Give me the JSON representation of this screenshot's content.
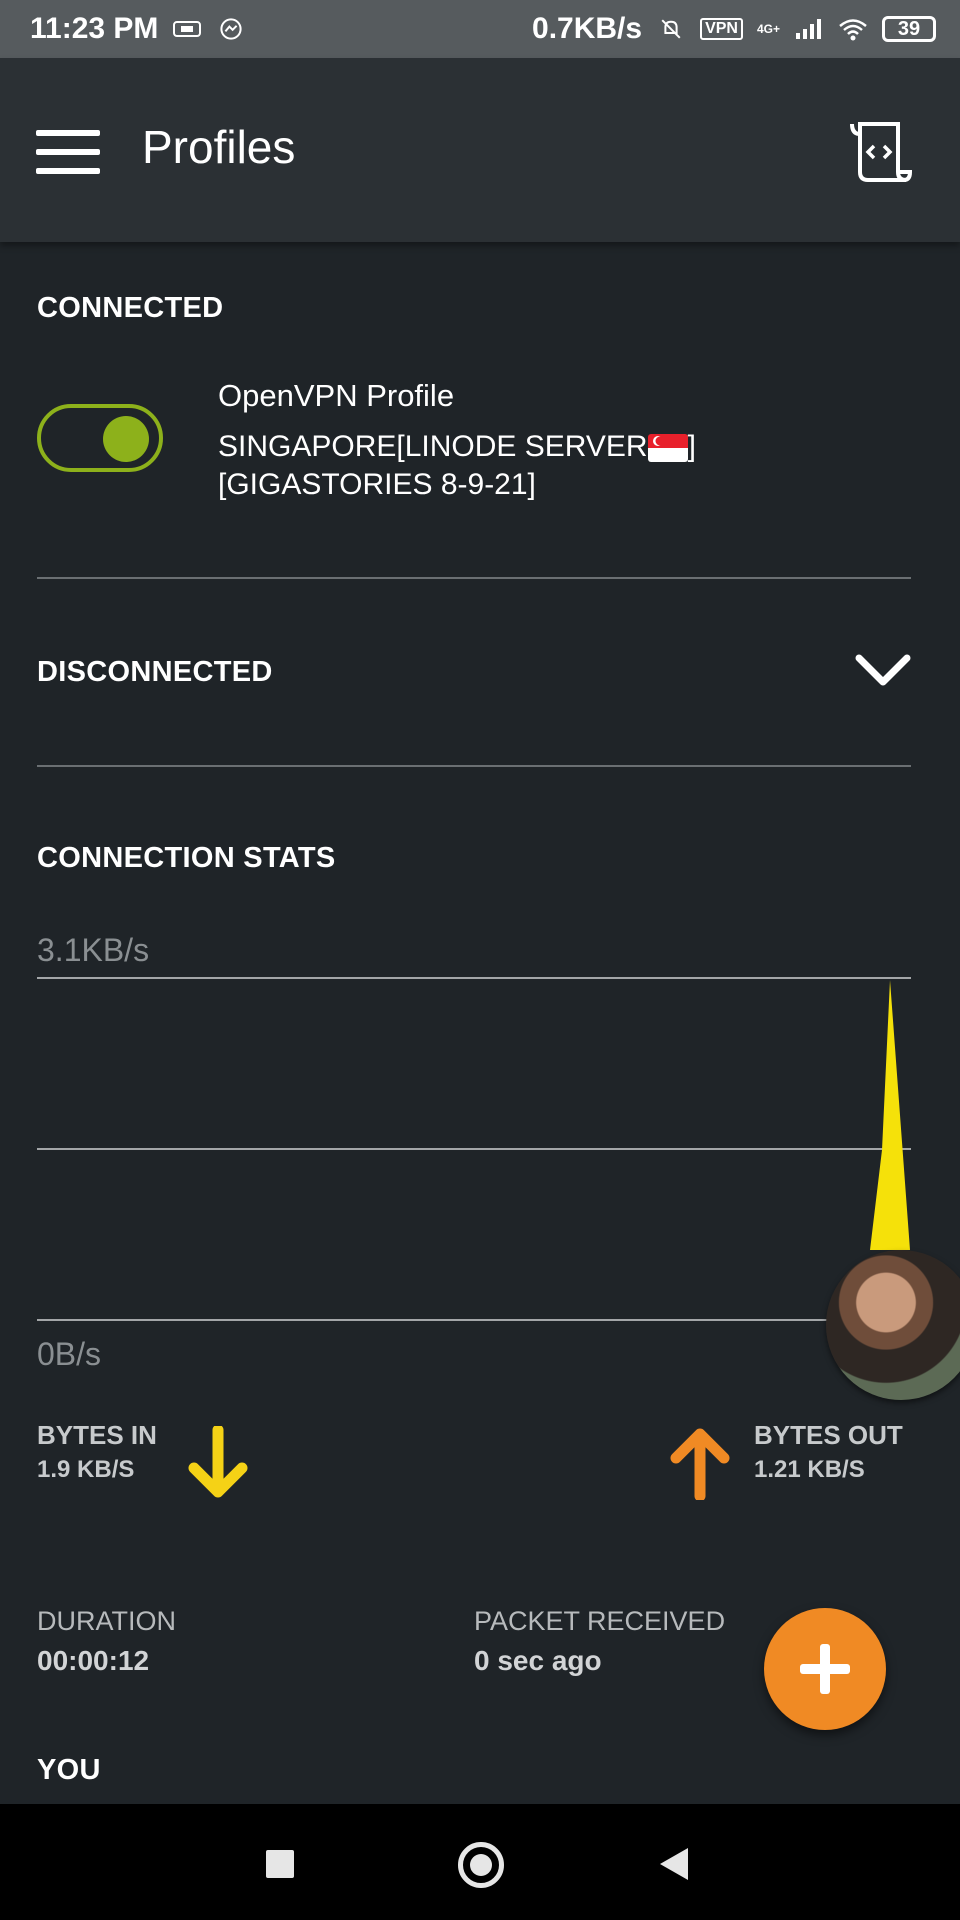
{
  "status_bar": {
    "time": "11:23 PM",
    "speed": "0.7KB/s",
    "vpn_badge": "VPN",
    "network": "4G+",
    "battery": "39",
    "icons": [
      "sim-card-icon",
      "messenger-icon",
      "muted-bell-icon",
      "vpn-key-icon",
      "signal-icon",
      "wifi-icon",
      "battery-icon"
    ]
  },
  "app_bar": {
    "title": "Profiles",
    "icons": [
      "menu-icon",
      "log-file-icon"
    ]
  },
  "connected": {
    "heading": "CONNECTED",
    "profile_name": "OpenVPN Profile",
    "profile_detail_line1": "SINGAPORE[LINODE SERVER",
    "profile_detail_close": "]",
    "profile_detail_line2": "[GIGASTORIES 8-9-21]",
    "toggle_on": true,
    "accent": "#8db11b"
  },
  "disconnected": {
    "heading": "DISCONNECTED"
  },
  "stats": {
    "heading": "CONNECTION STATS",
    "max_label": "3.1KB/s",
    "min_label": "0B/s",
    "bytes_in_label": "BYTES IN",
    "bytes_in_value": "1.9 KB/S",
    "bytes_out_label": "BYTES OUT",
    "bytes_out_value": "1.21 KB/S",
    "in_color": "#f5d216",
    "out_color": "#f08a24"
  },
  "info": {
    "duration_label": "DURATION",
    "duration_value": "00:00:12",
    "packet_label": "PACKET RECEIVED",
    "packet_value": "0 sec ago"
  },
  "you": {
    "heading": "YOU"
  },
  "colors": {
    "background": "#1f2428",
    "app_bar": "#2b3034",
    "status_bar": "#565b5e",
    "fab": "#f08a24"
  }
}
